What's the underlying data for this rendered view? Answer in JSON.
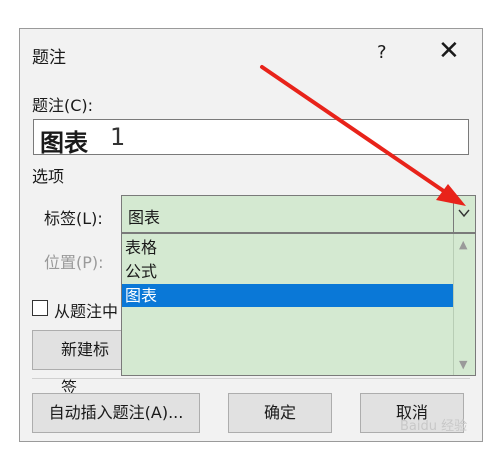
{
  "dialog": {
    "title": "题注",
    "help_label": "?",
    "close_label": "✕"
  },
  "caption": {
    "label": "题注(C):",
    "value_label": "图表",
    "value_number": "1"
  },
  "options": {
    "section_title": "选项",
    "label_field_label": "标签(L):",
    "label_value": "图表",
    "position_label": "位置(P):",
    "dropdown_items": [
      "表格",
      "公式",
      "图表"
    ],
    "selected_index": 2,
    "exclude_label_text": "从题注中",
    "new_label_button": "新建标签"
  },
  "footer": {
    "autocaption_button": "自动插入题注(A)...",
    "ok_button": "确定",
    "cancel_button": "取消"
  },
  "watermark": "Baidu 经验",
  "colors": {
    "list_bg": "#d4e9d1",
    "selected_bg": "#0a78d7",
    "arrow": "#e8231a"
  }
}
